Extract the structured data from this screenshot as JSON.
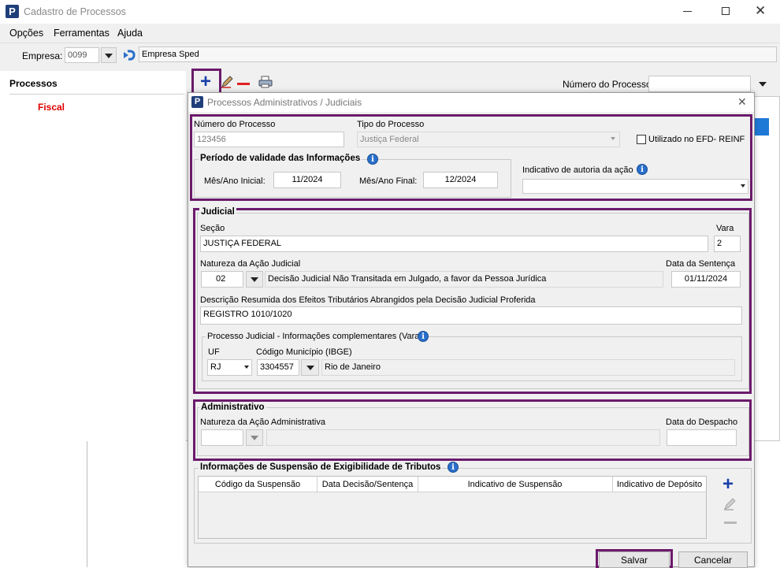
{
  "main_window": {
    "title": "Cadastro de Processos",
    "menu": [
      "Opções",
      "Ferramentas",
      "Ajuda"
    ],
    "empresa_label": "Empresa:",
    "empresa_code": "0099",
    "empresa_name": "Empresa Sped",
    "sidebar_title": "Processos",
    "sidebar_item": "Fiscal",
    "numero_processo_label": "Número do Processo:"
  },
  "dialog": {
    "title": "Processos Administrativos / Judiciais",
    "numero_processo_label": "Número do Processo",
    "numero_processo_value": "123456",
    "tipo_processo_label": "Tipo do Processo",
    "tipo_processo_value": "Justiça Federal",
    "efd_checkbox_label": "Utilizado no EFD- REINF",
    "periodo_title": "Período de validade das Informações",
    "mes_inicial_label": "Mês/Ano Inicial:",
    "mes_inicial_value": "11/2024",
    "mes_final_label": "Mês/Ano Final:",
    "mes_final_value": "12/2024",
    "autoria_label": "Indicativo de autoria da ação",
    "autoria_value": "",
    "judicial": {
      "title": "Judicial",
      "secao_label": "Seção",
      "secao_value": "JUSTIÇA FEDERAL",
      "vara_label": "Vara",
      "vara_value": "2",
      "natureza_label": "Natureza da Ação Judicial",
      "natureza_code": "02",
      "natureza_desc": "Decisão Judicial Não Transitada em Julgado, a favor da Pessoa Jurídica",
      "data_sentenca_label": "Data da Sentença",
      "data_sentenca_value": "01/11/2024",
      "descricao_label": "Descrição Resumida dos Efeitos Tributários Abrangidos pela Decisão Judicial Proferida",
      "descricao_value": "REGISTRO 1010/1020",
      "complementar_title": "Processo Judicial - Informações complementares (Vara)",
      "uf_label": "UF",
      "uf_value": "RJ",
      "municipio_label": "Código Município (IBGE)",
      "municipio_code": "3304557",
      "municipio_name": "Rio de Janeiro"
    },
    "administrativo": {
      "title": "Administrativo",
      "natureza_label": "Natureza da Ação Administrativa",
      "data_despacho_label": "Data do Despacho"
    },
    "suspensao": {
      "title": "Informações de Suspensão de Exigibilidade de Tributos",
      "columns": [
        "Código da Suspensão",
        "Data Decisão/Sentença",
        "Indicativo de Suspensão",
        "Indicativo de Depósito"
      ]
    },
    "buttons": {
      "save": "Salvar",
      "cancel": "Cancelar"
    }
  },
  "colors": {
    "highlight": "#6b1a6b",
    "accent_blue": "#1a3fa8",
    "sidebar_item": "#e00000"
  }
}
